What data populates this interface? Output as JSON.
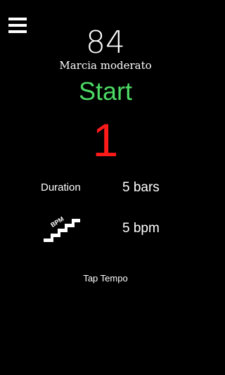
{
  "header": {
    "menu_icon": "hamburger-menu-icon"
  },
  "tempo": {
    "bpm": "84",
    "marking": "Marcia moderato"
  },
  "controls": {
    "start_label": "Start",
    "beat_count": "1"
  },
  "settings": {
    "duration_label": "Duration",
    "duration_value": "5 bars",
    "increment_icon": "bpm-stairs-icon",
    "increment_icon_text": "BPM",
    "increment_value": "5 bpm"
  },
  "footer": {
    "tap_tempo_label": "Tap Tempo"
  },
  "colors": {
    "background": "#000000",
    "text": "#ffffff",
    "start": "#4cd964",
    "beat": "#ff1a1a"
  }
}
